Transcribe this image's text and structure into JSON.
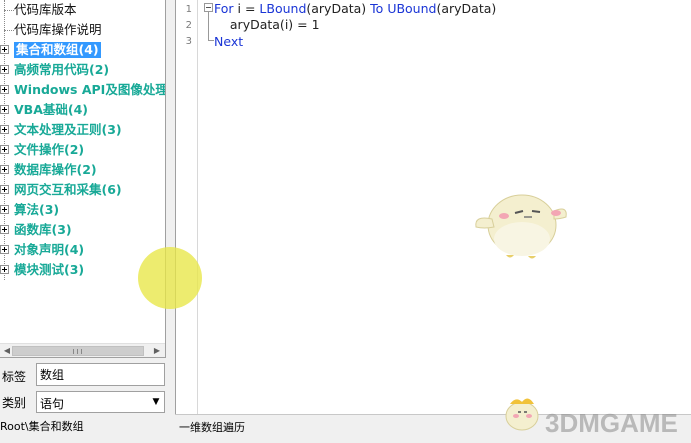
{
  "tree": {
    "items": [
      {
        "label": "代码库版本",
        "kind": "leaf"
      },
      {
        "label": "代码库操作说明",
        "kind": "leaf"
      },
      {
        "label": "集合和数组(4)",
        "kind": "group",
        "selected": true
      },
      {
        "label": "高频常用代码(2)",
        "kind": "group"
      },
      {
        "label": "Windows API及图像处理(",
        "kind": "group"
      },
      {
        "label": "VBA基础(4)",
        "kind": "group"
      },
      {
        "label": "文本处理及正则(3)",
        "kind": "group"
      },
      {
        "label": "文件操作(2)",
        "kind": "group"
      },
      {
        "label": "数据库操作(2)",
        "kind": "group"
      },
      {
        "label": "网页交互和采集(6)",
        "kind": "group"
      },
      {
        "label": "算法(3)",
        "kind": "group"
      },
      {
        "label": "函数库(3)",
        "kind": "group"
      },
      {
        "label": "对象声明(4)",
        "kind": "group"
      },
      {
        "label": "模块测试(3)",
        "kind": "group"
      }
    ]
  },
  "fields": {
    "tag_label": "标签",
    "tag_value": "数组",
    "type_label": "类别",
    "type_value": "语句"
  },
  "path": "Root\\集合和数组",
  "editor": {
    "line_numbers": [
      "1",
      "2",
      "3"
    ],
    "line1": {
      "kw1": "For",
      "t1": " i = ",
      "kw2": "LBound",
      "t2": "(aryData) ",
      "kw3": "To",
      "t3": " ",
      "kw4": "UBound",
      "t4": "(aryData)"
    },
    "line2": "    aryData(i) = 1",
    "line3": "Next",
    "status": "一维数组遍历"
  },
  "watermark": "3DMGAME",
  "colors": {
    "group_text": "#18a997",
    "selected_bg": "#3399ff",
    "keyword": "#1a35d6"
  }
}
